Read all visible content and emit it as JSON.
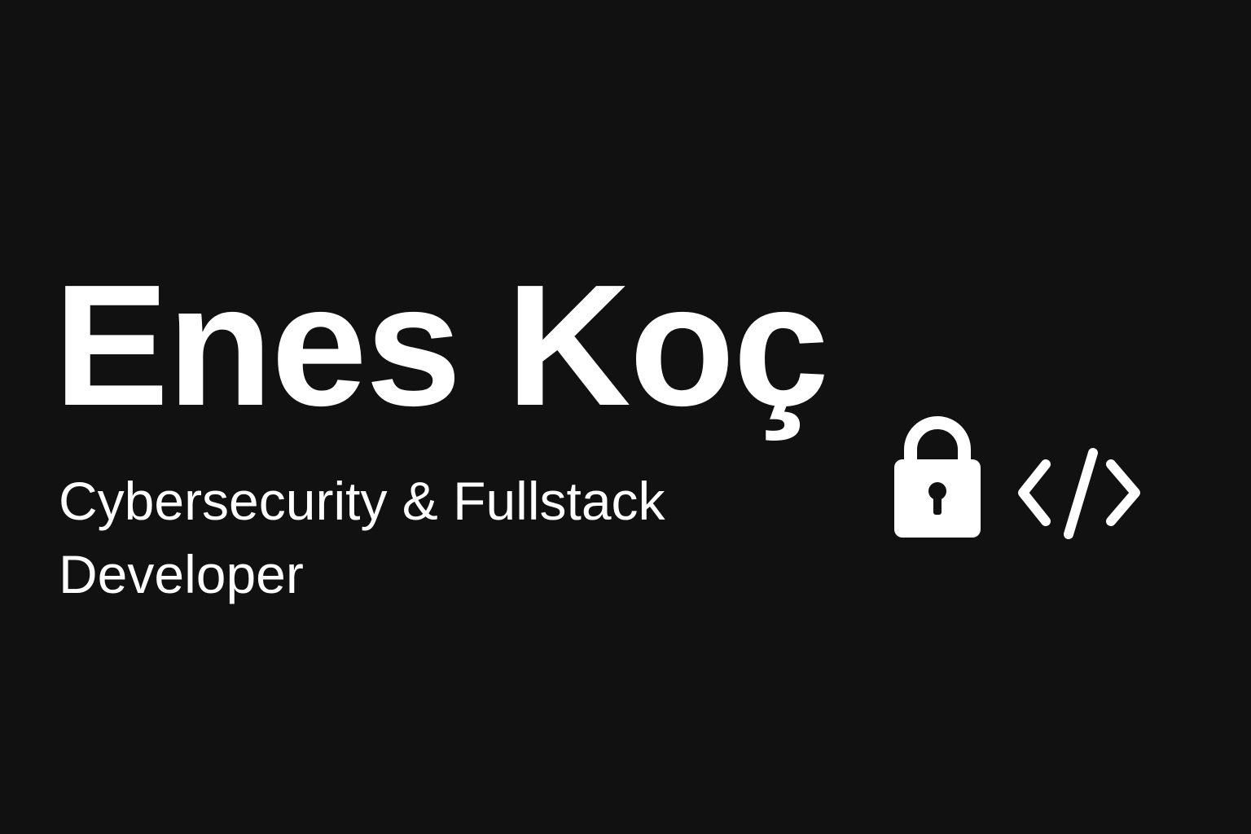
{
  "hero": {
    "name": "Enes Koç",
    "tagline": "Cybersecurity & Fullstack Developer"
  },
  "icons": [
    "lock-icon",
    "code-icon"
  ],
  "colors": {
    "background": "#111111",
    "foreground": "#ffffff"
  }
}
